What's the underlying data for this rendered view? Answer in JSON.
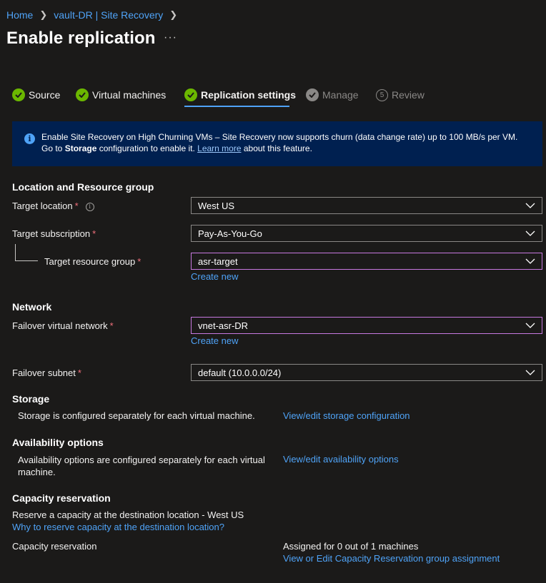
{
  "breadcrumb": [
    "Home",
    "vault-DR | Site Recovery"
  ],
  "page_title": "Enable replication",
  "more_label": "···",
  "steps": [
    {
      "label": "Source",
      "state": "done"
    },
    {
      "label": "Virtual machines",
      "state": "done"
    },
    {
      "label": "Replication settings",
      "state": "active"
    },
    {
      "label": "Manage",
      "state": "disabled"
    },
    {
      "label": "Review",
      "state": "disabled",
      "number": "5"
    }
  ],
  "banner": {
    "text_1": "Enable Site Recovery on High Churning VMs – Site Recovery now supports churn (data change rate) up to 100 MB/s per VM. Go to ",
    "bold": "Storage",
    "text_2": " configuration to enable it. ",
    "link": "Learn more",
    "text_3": " about this feature."
  },
  "location": {
    "heading": "Location and Resource group",
    "target_location_label": "Target location",
    "target_location_value": "West US",
    "target_subscription_label": "Target subscription",
    "target_subscription_value": "Pay-As-You-Go",
    "target_rg_label": "Target resource group",
    "target_rg_value": "asr-target",
    "create_new": "Create new"
  },
  "network": {
    "heading": "Network",
    "vnet_label": "Failover virtual network",
    "vnet_value": "vnet-asr-DR",
    "create_new": "Create new",
    "subnet_label": "Failover subnet",
    "subnet_value": "default (10.0.0.0/24)"
  },
  "storage": {
    "heading": "Storage",
    "description": "Storage is configured separately for each virtual machine.",
    "link": "View/edit storage configuration"
  },
  "availability": {
    "heading": "Availability options",
    "description_1": "Availability options are configured separately for each virtual",
    "description_2": "machine.",
    "link": "View/edit availability options"
  },
  "capacity": {
    "heading": "Capacity reservation",
    "description": "Reserve a capacity at the destination location - West US",
    "why_link": "Why to reserve capacity at the destination location?",
    "label": "Capacity reservation",
    "assigned": "Assigned for 0 out of 1 machines",
    "edit_link": "View or Edit Capacity Reservation group assignment"
  },
  "required_mark": "*",
  "colors": {
    "accent": "#4fa3f7",
    "done": "#6bb700",
    "banner_bg": "#002050",
    "required": "#f1707b",
    "focus_border": "#c879e0"
  }
}
